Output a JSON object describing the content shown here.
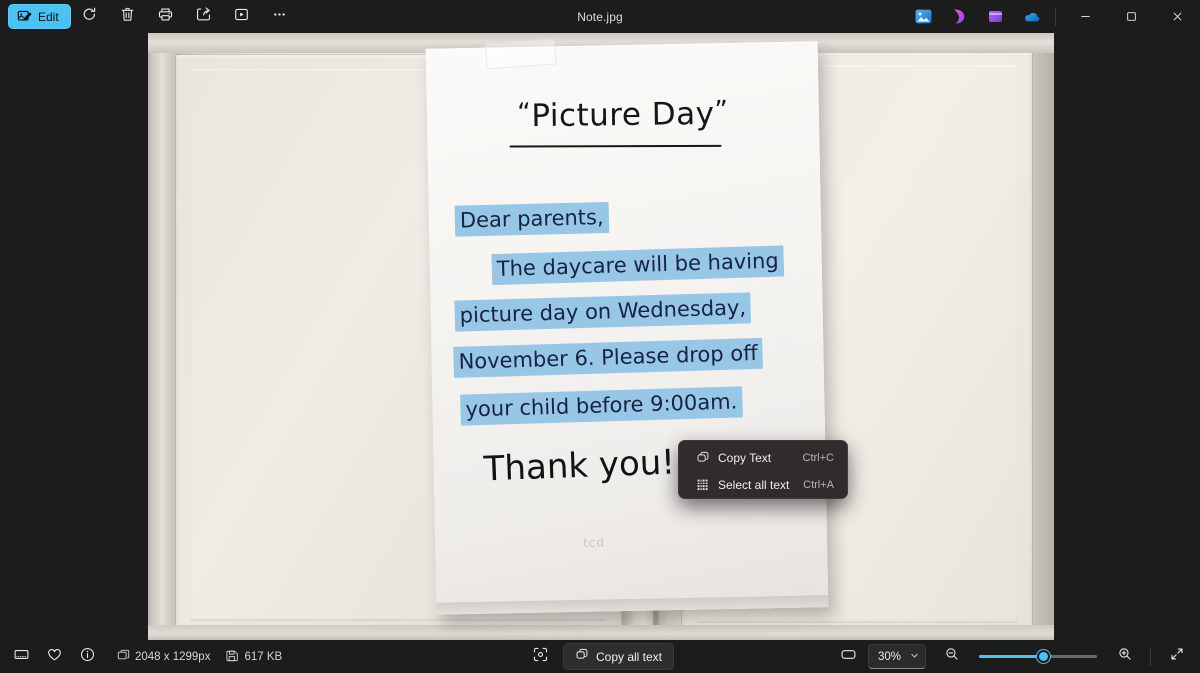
{
  "window": {
    "title": "Note.jpg",
    "accent_color": "#4cc2f1",
    "background": "#1c1c1c"
  },
  "toolbar": {
    "edit_label": "Edit",
    "buttons": [
      {
        "name": "rotate-icon",
        "tooltip": "Rotate"
      },
      {
        "name": "delete-icon",
        "tooltip": "Delete"
      },
      {
        "name": "print-icon",
        "tooltip": "Print"
      },
      {
        "name": "share-icon",
        "tooltip": "Share"
      },
      {
        "name": "slideshow-icon",
        "tooltip": "Slideshow"
      },
      {
        "name": "more-icon",
        "tooltip": "See more"
      }
    ],
    "app_icons": [
      {
        "name": "photos-app-icon"
      },
      {
        "name": "designer-app-icon"
      },
      {
        "name": "clipchamp-app-icon"
      },
      {
        "name": "onedrive-app-icon"
      }
    ],
    "window_controls": {
      "minimize": "–",
      "maximize": "☐",
      "close": "✕"
    }
  },
  "context_menu": {
    "items": [
      {
        "label": "Copy Text",
        "shortcut": "Ctrl+C",
        "icon": "copy-text-icon"
      },
      {
        "label": "Select all text",
        "shortcut": "Ctrl+A",
        "icon": "select-all-text-icon"
      }
    ]
  },
  "statusbar": {
    "icons": [
      {
        "name": "filmstrip-icon"
      },
      {
        "name": "favorite-heart-icon"
      },
      {
        "name": "info-icon"
      }
    ],
    "dimensions": "2048 x 1299px",
    "filesize": "617 KB",
    "scan_text_icon": "scan-text-icon",
    "copy_all_label": "Copy all text",
    "fit_icon": "fit-to-window-icon",
    "zoom_value": "30%",
    "zoom_out_icon": "zoom-out-icon",
    "zoom_in_icon": "zoom-in-icon",
    "fullscreen_icon": "fullscreen-icon",
    "zoom_slider_percent": 55
  },
  "photo": {
    "alt": "Handwritten note taped to a white cabinet door",
    "note": {
      "title_open_quote": "“",
      "title": "Picture Day",
      "title_close_quote": "”",
      "lines": [
        "Dear parents,",
        "The daycare will be having",
        "picture day on Wednesday,",
        "November 6. Please drop off",
        "your child before 9:00am."
      ],
      "closing": "Thank you!",
      "faint_mark": "tcd",
      "highlight_color": "#97c6e6",
      "ink_color": "#16243f"
    }
  }
}
